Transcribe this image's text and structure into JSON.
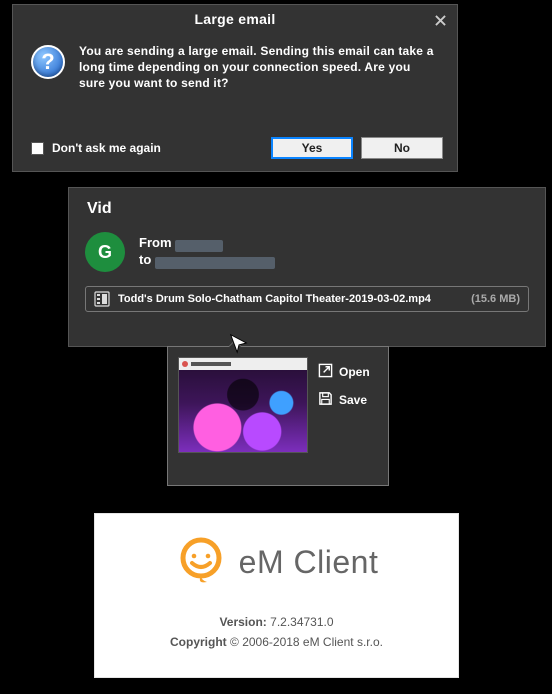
{
  "dialog": {
    "title": "Large email",
    "message": "You are sending a large email. Sending this email can take a long time depending on your connection speed. Are you sure you want to send it?",
    "dont_ask": "Don't ask me again",
    "yes": "Yes",
    "no": "No",
    "info_glyph": "?"
  },
  "email": {
    "subject": "Vid",
    "avatar_initial": "G",
    "from_label": "From",
    "to_label": "to",
    "attachment": {
      "name": "Todd's Drum Solo-Chatham Capitol Theater-2019-03-02.mp4",
      "size": "(15.6 MB)"
    }
  },
  "popover": {
    "open": "Open",
    "save": "Save"
  },
  "about": {
    "brand": "eM Client",
    "version_label": "Version:",
    "version_value": "7.2.34731.0",
    "copyright_label": "Copyright",
    "copyright_value": "© 2006-2018 eM Client s.r.o."
  },
  "colors": {
    "panel_bg": "#333333",
    "accent_blue": "#0a84ff",
    "avatar_green": "#1e8e3e",
    "brand_orange": "#f7a028"
  }
}
